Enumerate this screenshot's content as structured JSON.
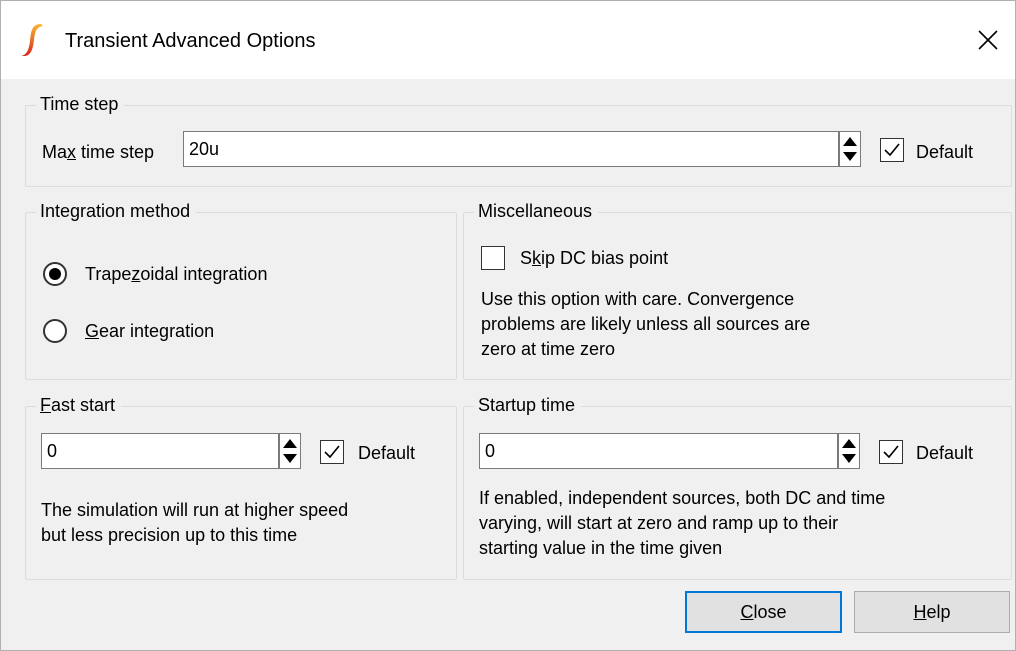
{
  "window": {
    "title": "Transient Advanced Options",
    "icon": "simetrix-logo-icon",
    "close_icon": "close-icon"
  },
  "time_step": {
    "title": "Time step",
    "max_label_pre": "Ma",
    "max_label_ul": "x",
    "max_label_post": " time step",
    "value": "20u",
    "default_label": "Default",
    "default_checked": true
  },
  "integration": {
    "title": "Integration method",
    "trap_pre": "Trape",
    "trap_ul": "z",
    "trap_post": "oidal integration",
    "trap_selected": true,
    "gear_ul": "G",
    "gear_post": "ear integration",
    "gear_selected": false
  },
  "misc": {
    "title": "Miscellaneous",
    "skip_pre": "S",
    "skip_ul": "k",
    "skip_post": "ip DC bias point",
    "skip_checked": false,
    "desc_lines": [
      "Use this option with care. Convergence",
      "problems are likely unless all sources are",
      "zero at time zero"
    ]
  },
  "fast_start": {
    "title_ul": "F",
    "title_post": "ast start",
    "value": "0",
    "default_label": "Default",
    "default_checked": true,
    "desc_lines": [
      "The simulation will run at higher speed",
      "but less precision up to this time"
    ]
  },
  "startup": {
    "title": "Startup time",
    "value": "0",
    "default_label": "Default",
    "default_checked": true,
    "desc_lines": [
      "If enabled, independent sources, both DC and time",
      "varying, will start at zero and ramp up to their",
      "starting value in the time given"
    ]
  },
  "buttons": {
    "close_ul": "C",
    "close_post": "lose",
    "help_ul": "H",
    "help_post": "elp"
  },
  "colors": {
    "accent": "#0078d7",
    "background": "#f0f0f0",
    "logo_top": "#f5a623",
    "logo_bottom": "#d0021b"
  }
}
